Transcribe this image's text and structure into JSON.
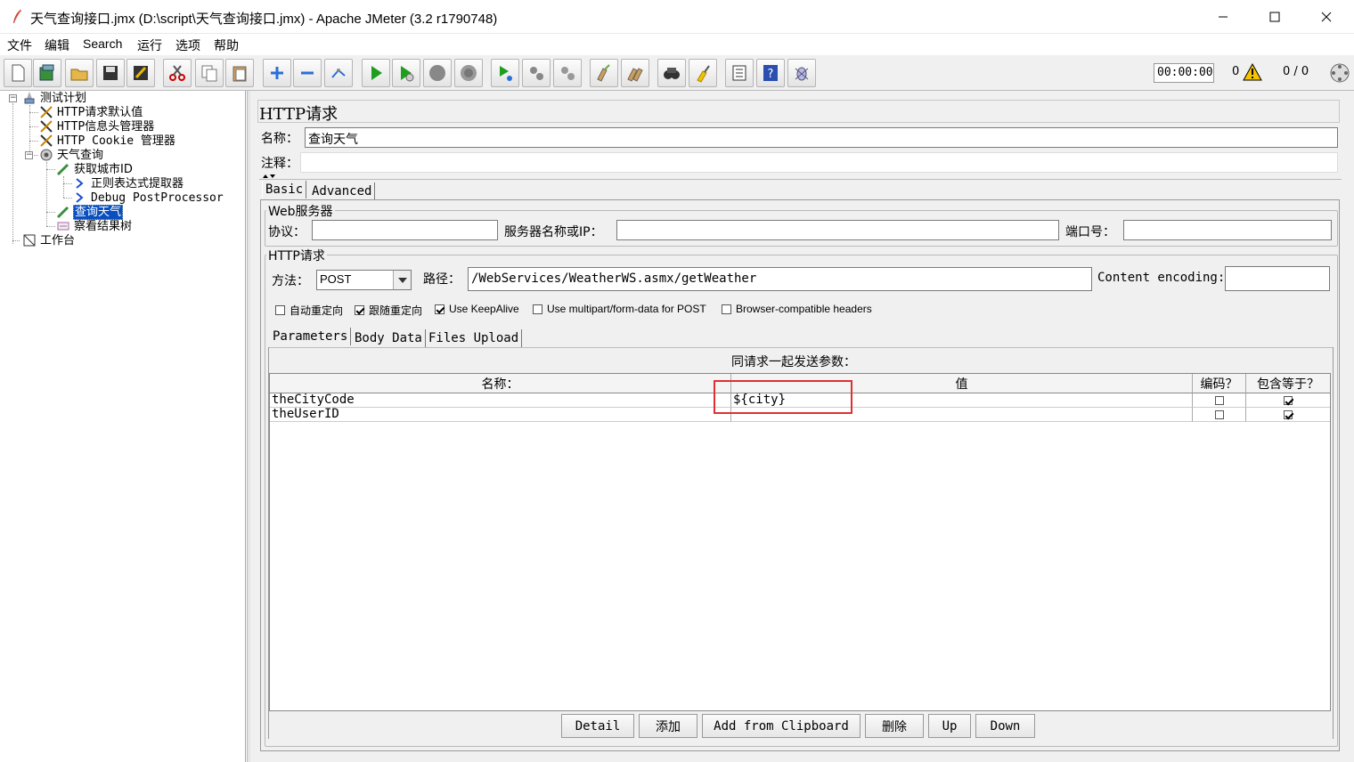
{
  "window": {
    "title": "天气查询接口.jmx (D:\\script\\天气查询接口.jmx) - Apache JMeter (3.2 r1790748)"
  },
  "menu": [
    "文件",
    "编辑",
    "Search",
    "运行",
    "选项",
    "帮助"
  ],
  "toolbar": {
    "timer": "00:00:00",
    "warning_count": "0",
    "threads": "0 / 0",
    "buttons": [
      "new-icon",
      "templates-icon",
      "open-icon",
      "save-icon",
      "save-as-icon",
      "cut-icon",
      "copy-icon",
      "paste-icon",
      "expand-icon",
      "collapse-icon",
      "toggle-icon",
      "start-icon",
      "start-no-pause-icon",
      "stop-icon",
      "shutdown-icon",
      "remote-start-icon",
      "remote-stop-icon",
      "remote-shutdown-icon",
      "clear-icon",
      "clear-all-icon",
      "search-icon",
      "reset-search-icon",
      "function-helper-icon",
      "help-icon",
      "log-viewer-icon"
    ]
  },
  "tree": {
    "nodes": [
      {
        "label": "测试计划",
        "icon": "test-plan-icon"
      },
      {
        "label": "HTTP请求默认值",
        "icon": "config-element-icon"
      },
      {
        "label": "HTTP信息头管理器",
        "icon": "config-element-icon"
      },
      {
        "label": "HTTP Cookie 管理器",
        "icon": "config-element-icon"
      },
      {
        "label": "天气查询",
        "icon": "thread-group-icon"
      },
      {
        "label": "获取城市ID",
        "icon": "sampler-icon"
      },
      {
        "label": "正则表达式提取器",
        "icon": "post-processor-icon"
      },
      {
        "label": "Debug PostProcessor",
        "icon": "post-processor-icon"
      },
      {
        "label": "查询天气",
        "icon": "sampler-icon"
      },
      {
        "label": "察看结果树",
        "icon": "listener-icon"
      },
      {
        "label": "工作台",
        "icon": "workbench-icon"
      }
    ]
  },
  "panel": {
    "heading": "HTTP请求",
    "name_label": "名称：",
    "name_value": "查询天气",
    "comment_label": "注释：",
    "comment_value": "",
    "tabs": [
      "Basic",
      "Advanced"
    ],
    "web_server": {
      "title": "Web服务器",
      "protocol_label": "协议：",
      "protocol_value": "",
      "server_label": "服务器名称或IP：",
      "server_value": "",
      "port_label": "端口号：",
      "port_value": ""
    },
    "http_request": {
      "title": "HTTP请求",
      "method_label": "方法：",
      "method_value": "POST",
      "path_label": "路径：",
      "path_value": "/WebServices/WeatherWS.asmx/getWeather",
      "encoding_label": "Content encoding:",
      "encoding_value": ""
    },
    "options": [
      {
        "label": "自动重定向",
        "checked": false
      },
      {
        "label": "跟随重定向",
        "checked": true
      },
      {
        "label": "Use KeepAlive",
        "checked": true
      },
      {
        "label": "Use multipart/form-data for POST",
        "checked": false
      },
      {
        "label": "Browser-compatible headers",
        "checked": false
      }
    ],
    "subtabs": [
      "Parameters",
      "Body Data",
      "Files Upload"
    ],
    "params_caption": "同请求一起发送参数：",
    "columns": [
      "名称：",
      "值",
      "编码？",
      "包含等于？"
    ],
    "rows": [
      {
        "name": "theCityCode",
        "value": "${city}",
        "encode": false,
        "include_equals": true
      },
      {
        "name": "theUserID",
        "value": "",
        "encode": false,
        "include_equals": true
      }
    ],
    "buttons": [
      "Detail",
      "添加",
      "Add from Clipboard",
      "删除",
      "Up",
      "Down"
    ],
    "highlight_color": "#e03030"
  }
}
